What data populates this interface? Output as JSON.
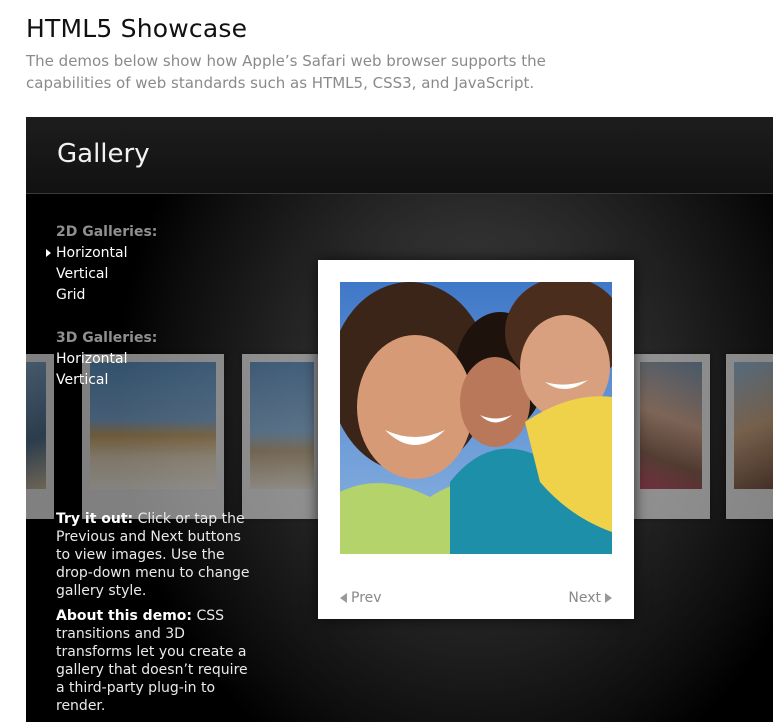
{
  "page": {
    "title": "HTML5 Showcase",
    "subtitle_line1": "The demos below show how Apple’s Safari web browser supports the",
    "subtitle_line2": "capabilities of web standards such as HTML5, CSS3, and JavaScript."
  },
  "demo": {
    "title": "Gallery",
    "nav": {
      "group_2d": {
        "heading": "2D Galleries:",
        "items": [
          {
            "label": "Horizontal",
            "selected": true
          },
          {
            "label": "Vertical",
            "selected": false
          },
          {
            "label": "Grid",
            "selected": false
          }
        ]
      },
      "group_3d": {
        "heading": "3D Galleries:",
        "items": [
          {
            "label": "Horizontal",
            "selected": false
          },
          {
            "label": "Vertical",
            "selected": false
          }
        ]
      }
    },
    "description": {
      "try_label": "Try it out:",
      "try_text": " Click or tap the Previous and Next buttons to view images. Use the drop-down menu to change gallery style.",
      "about_label": "About this demo:",
      "about_text": " CSS transitions and 3D transforms let you create a gallery that doesn’t require a third-party plug-in to render."
    },
    "viewer": {
      "prev_label": "Prev",
      "next_label": "Next",
      "prev_icon": "triangle-left-icon",
      "next_icon": "triangle-right-icon"
    }
  },
  "colors": {
    "demo_background": "#000000",
    "nav_heading": "#8f8f8f",
    "button_text": "#888888"
  }
}
